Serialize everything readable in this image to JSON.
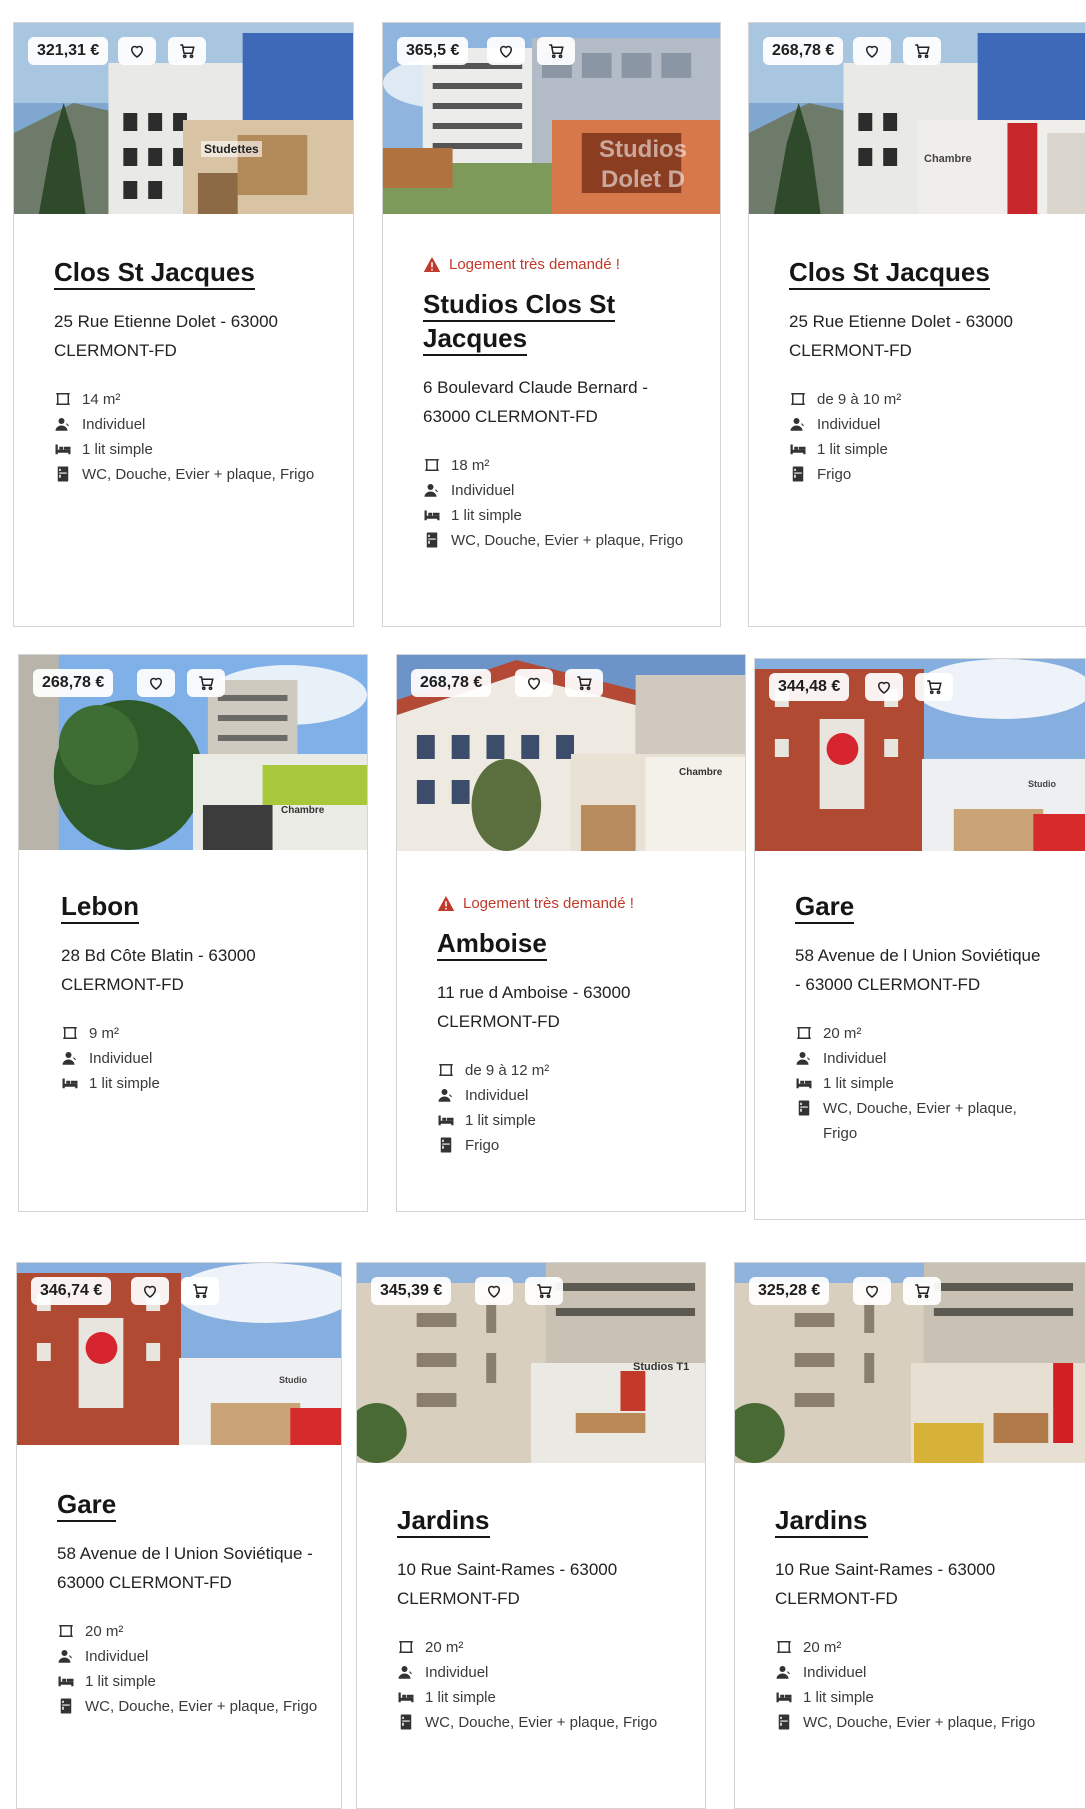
{
  "cards": [
    {
      "price": "321,31 €",
      "alert": "",
      "title": "Clos St Jacques",
      "address": "25 Rue Etienne Dolet - 63000 CLERMONT-FD",
      "surface": "14 m²",
      "occupancy": "Individuel",
      "bed": "1 lit simple",
      "amenities": "WC, Douche, Evier + plaque, Frigo",
      "photo_caption": "Studettes"
    },
    {
      "price": "365,5 €",
      "alert": "Logement très demandé !",
      "title": "Studios Clos St Jacques",
      "address": "6 Boulevard Claude Bernard - 63000 CLERMONT-FD",
      "surface": "18 m²",
      "occupancy": "Individuel",
      "bed": "1 lit simple",
      "amenities": "WC, Douche, Evier + plaque, Frigo",
      "photo_caption": "Studios Dolet D"
    },
    {
      "price": "268,78 €",
      "alert": "",
      "title": "Clos St Jacques",
      "address": "25 Rue Etienne Dolet - 63000 CLERMONT-FD",
      "surface": "de 9 à 10 m²",
      "occupancy": "Individuel",
      "bed": "1 lit simple",
      "amenities": "Frigo",
      "photo_caption": "Chambre"
    },
    {
      "price": "268,78 €",
      "alert": "",
      "title": "Lebon",
      "address": "28 Bd Côte Blatin - 63000 CLERMONT-FD",
      "surface": "9 m²",
      "occupancy": "Individuel",
      "bed": "1 lit simple",
      "amenities": "",
      "photo_caption": "Chambre"
    },
    {
      "price": "268,78 €",
      "alert": "Logement très demandé !",
      "title": "Amboise",
      "address": "11 rue d Amboise - 63000 CLERMONT-FD",
      "surface": "de 9 à 12 m²",
      "occupancy": "Individuel",
      "bed": "1 lit simple",
      "amenities": "Frigo",
      "photo_caption": "Chambre"
    },
    {
      "price": "344,48 €",
      "alert": "",
      "title": "Gare",
      "address": "58 Avenue de l Union Soviétique - 63000 CLERMONT-FD",
      "surface": "20 m²",
      "occupancy": "Individuel",
      "bed": "1 lit simple",
      "amenities": "WC, Douche, Evier + plaque, Frigo",
      "photo_caption": "Studio"
    },
    {
      "price": "346,74 €",
      "alert": "",
      "title": "Gare",
      "address": "58 Avenue de l Union Soviétique - 63000 CLERMONT-FD",
      "surface": "20 m²",
      "occupancy": "Individuel",
      "bed": "1 lit simple",
      "amenities": "WC, Douche, Evier + plaque, Frigo",
      "photo_caption": "Studio"
    },
    {
      "price": "345,39 €",
      "alert": "",
      "title": "Jardins",
      "address": "10 Rue Saint-Rames - 63000 CLERMONT-FD",
      "surface": "20 m²",
      "occupancy": "Individuel",
      "bed": "1 lit simple",
      "amenities": "WC, Douche, Evier + plaque, Frigo",
      "photo_caption": "Studios T1"
    },
    {
      "price": "325,28 €",
      "alert": "",
      "title": "Jardins",
      "address": "10 Rue Saint-Rames - 63000 CLERMONT-FD",
      "surface": "20 m²",
      "occupancy": "Individuel",
      "bed": "1 lit simple",
      "amenities": "WC, Douche, Evier + plaque, Frigo",
      "photo_caption": ""
    }
  ],
  "icons": {
    "favorite": "heart-icon",
    "cart": "cart-icon",
    "surface": "surface-area-icon",
    "occupancy": "person-icon",
    "bed": "bed-icon",
    "amenities": "kitchen-icon",
    "alert": "warning-icon"
  },
  "colors": {
    "alert": "#c0392b",
    "title_underline": "#161616",
    "card_border": "#d4d4d4"
  }
}
